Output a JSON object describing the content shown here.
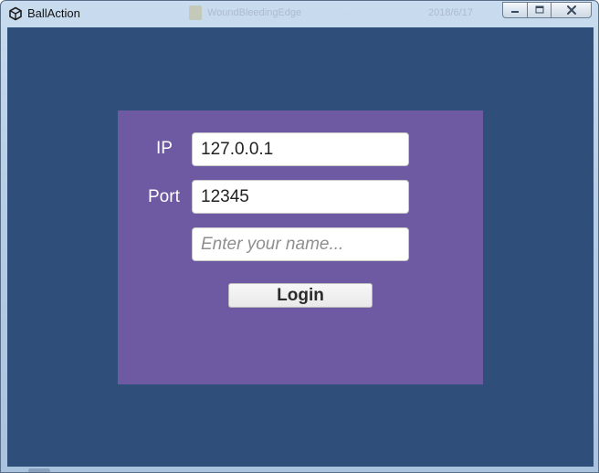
{
  "window": {
    "title": "BallAction",
    "background_title": "WoundBleedingEdge",
    "background_date": "2018/6/17"
  },
  "login_form": {
    "ip_label": "IP",
    "ip_value": "127.0.0.1",
    "port_label": "Port",
    "port_value": "12345",
    "name_placeholder": "Enter your name...",
    "name_value": "",
    "login_label": "Login"
  },
  "colors": {
    "client_background": "#2f4f7a",
    "panel_background": "#6e5aa2",
    "label_text": "#ffffff"
  },
  "icons": {
    "app": "unity-logo-icon",
    "minimize": "minimize-icon",
    "maximize": "maximize-icon",
    "close": "close-icon"
  }
}
